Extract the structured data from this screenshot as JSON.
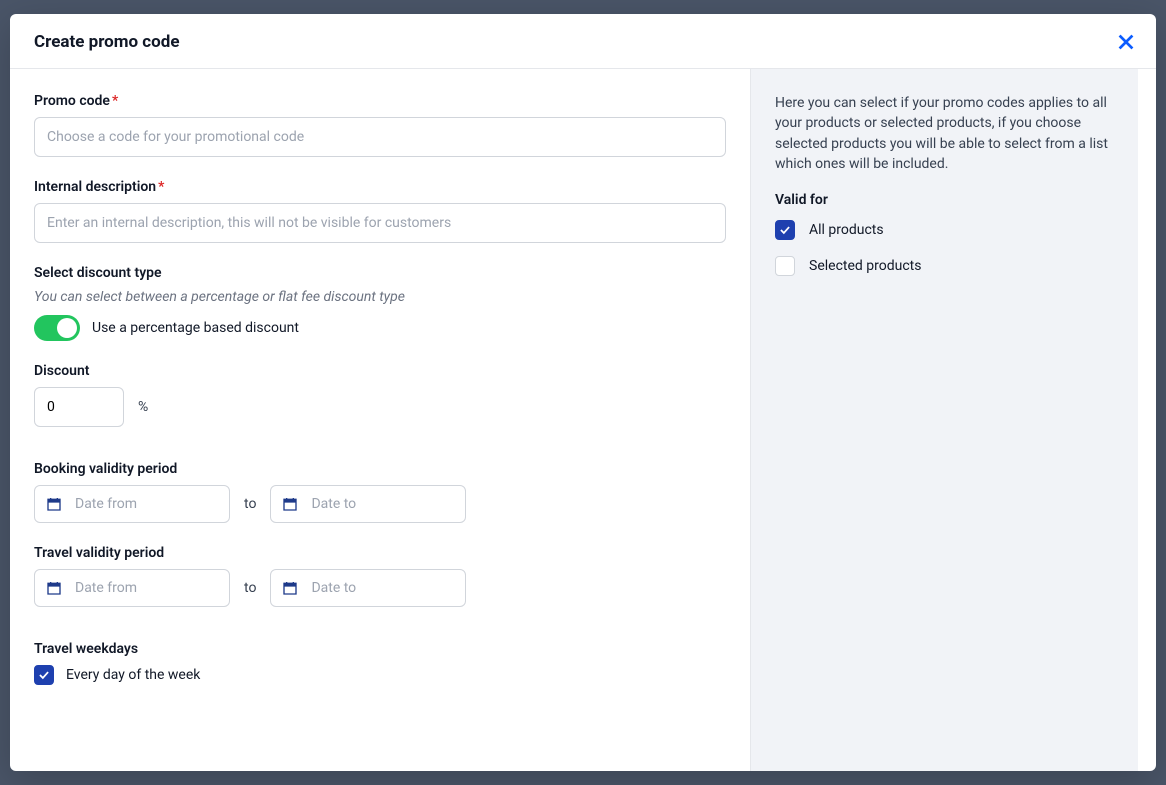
{
  "modal": {
    "title": "Create promo code"
  },
  "main": {
    "promo": {
      "label": "Promo code",
      "placeholder": "Choose a code for your promotional code"
    },
    "internal": {
      "label": "Internal description",
      "placeholder": "Enter an internal description, this will not be visible for customers"
    },
    "discountType": {
      "label": "Select discount type",
      "hint": "You can select between a percentage or flat fee discount type",
      "toggleLabel": "Use a percentage based discount",
      "toggleOn": true
    },
    "discount": {
      "label": "Discount",
      "value": "0",
      "unit": "%"
    },
    "booking": {
      "label": "Booking validity period",
      "fromPlaceholder": "Date from",
      "toPlaceholder": "Date to",
      "toText": "to"
    },
    "travel": {
      "label": "Travel validity period",
      "fromPlaceholder": "Date from",
      "toPlaceholder": "Date to",
      "toText": "to"
    },
    "weekdays": {
      "label": "Travel weekdays",
      "everyDayLabel": "Every day of the week",
      "everyDayChecked": true
    }
  },
  "side": {
    "description": "Here you can select if your promo codes applies to all your products or selected products, if you choose selected products you will be able to select from a list which ones will be included.",
    "validForLabel": "Valid for",
    "allProducts": {
      "label": "All products",
      "checked": true
    },
    "selectedProducts": {
      "label": "Selected products",
      "checked": false
    }
  }
}
